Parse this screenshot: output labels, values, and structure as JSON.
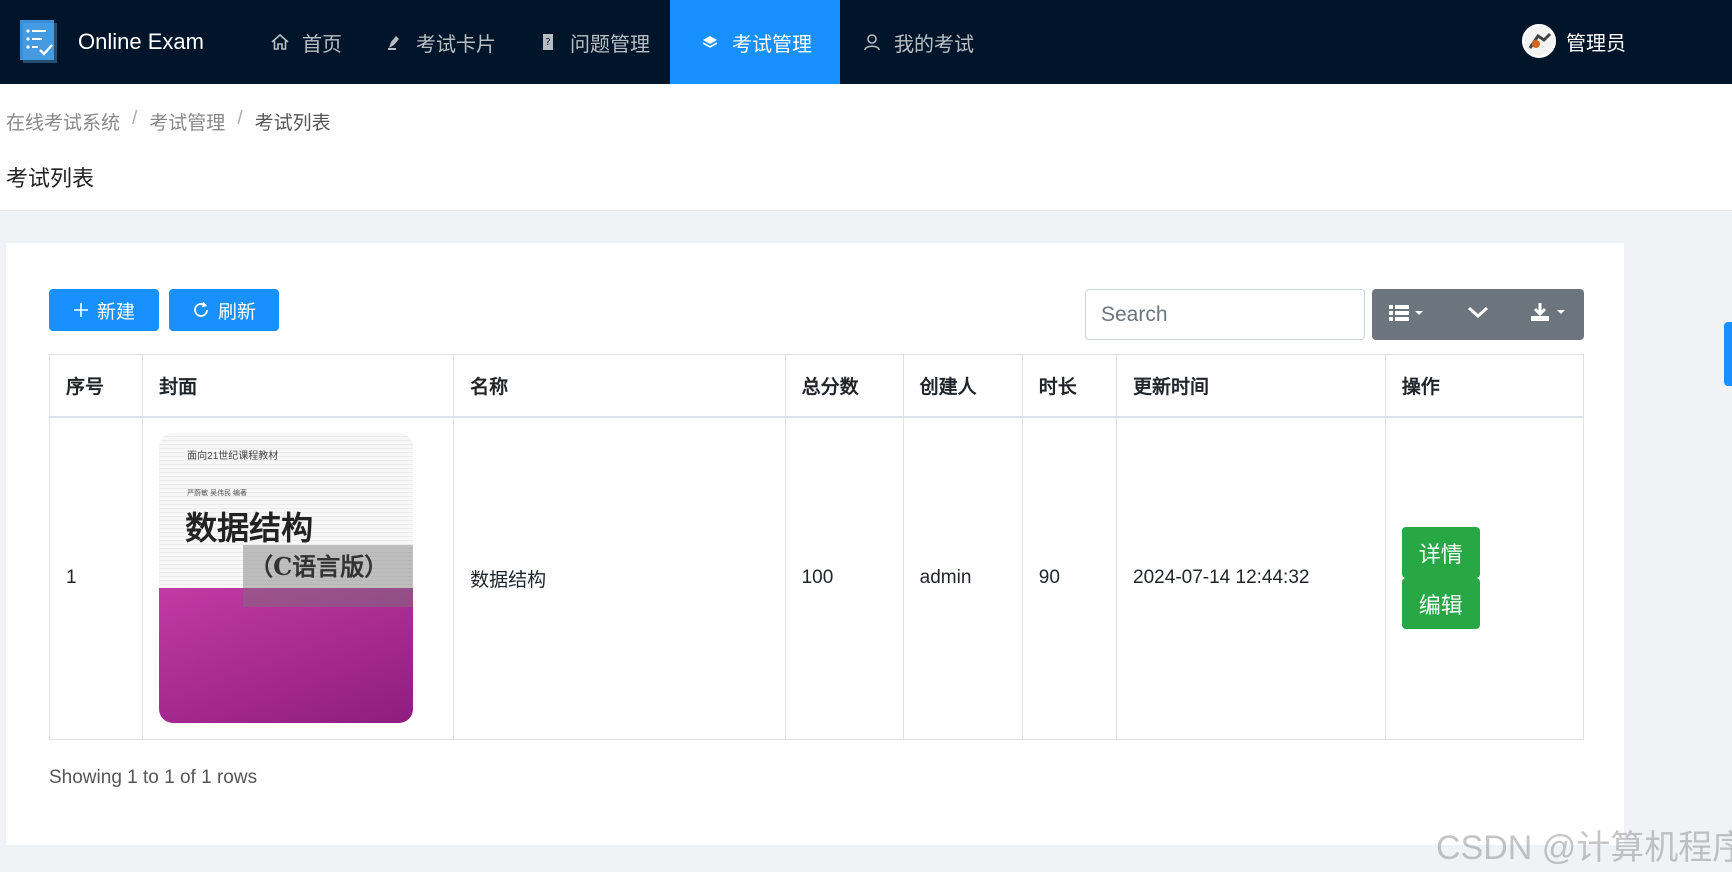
{
  "app": {
    "brand": "Online Exam"
  },
  "nav": [
    {
      "label": "首页",
      "icon": "home-icon"
    },
    {
      "label": "考试卡片",
      "icon": "pen-icon"
    },
    {
      "label": "问题管理",
      "icon": "question-icon"
    },
    {
      "label": "考试管理",
      "icon": "stack-icon",
      "active": true
    },
    {
      "label": "我的考试",
      "icon": "user-icon"
    }
  ],
  "user": {
    "name": "管理员"
  },
  "breadcrumb": [
    "在线考试系统",
    "考试管理",
    "考试列表"
  ],
  "page": {
    "title": "考试列表"
  },
  "toolbar": {
    "new_label": "新建",
    "refresh_label": "刷新",
    "search_placeholder": "Search"
  },
  "table": {
    "headers": [
      "序号",
      "封面",
      "名称",
      "总分数",
      "创建人",
      "时长",
      "更新时间",
      "操作"
    ],
    "rows": [
      {
        "index": "1",
        "cover": {
          "line1": "面向21世纪课程教材",
          "line2": "严蔚敏  吴伟民  编著",
          "title": "数据结构",
          "subtitle": "（C语言版）"
        },
        "name": "数据结构",
        "score": "100",
        "creator": "admin",
        "duration": "90",
        "updated": "2024-07-14 12:44:32",
        "actions": {
          "detail": "详情",
          "edit": "编辑"
        }
      }
    ]
  },
  "footer": {
    "info": "Showing 1 to 1 of 1 rows"
  },
  "watermark": "CSDN @计算机程序",
  "colors": {
    "nav_bg": "#001529",
    "accent": "#1890ff",
    "success": "#28a745",
    "tool_bg": "#6c757d"
  }
}
